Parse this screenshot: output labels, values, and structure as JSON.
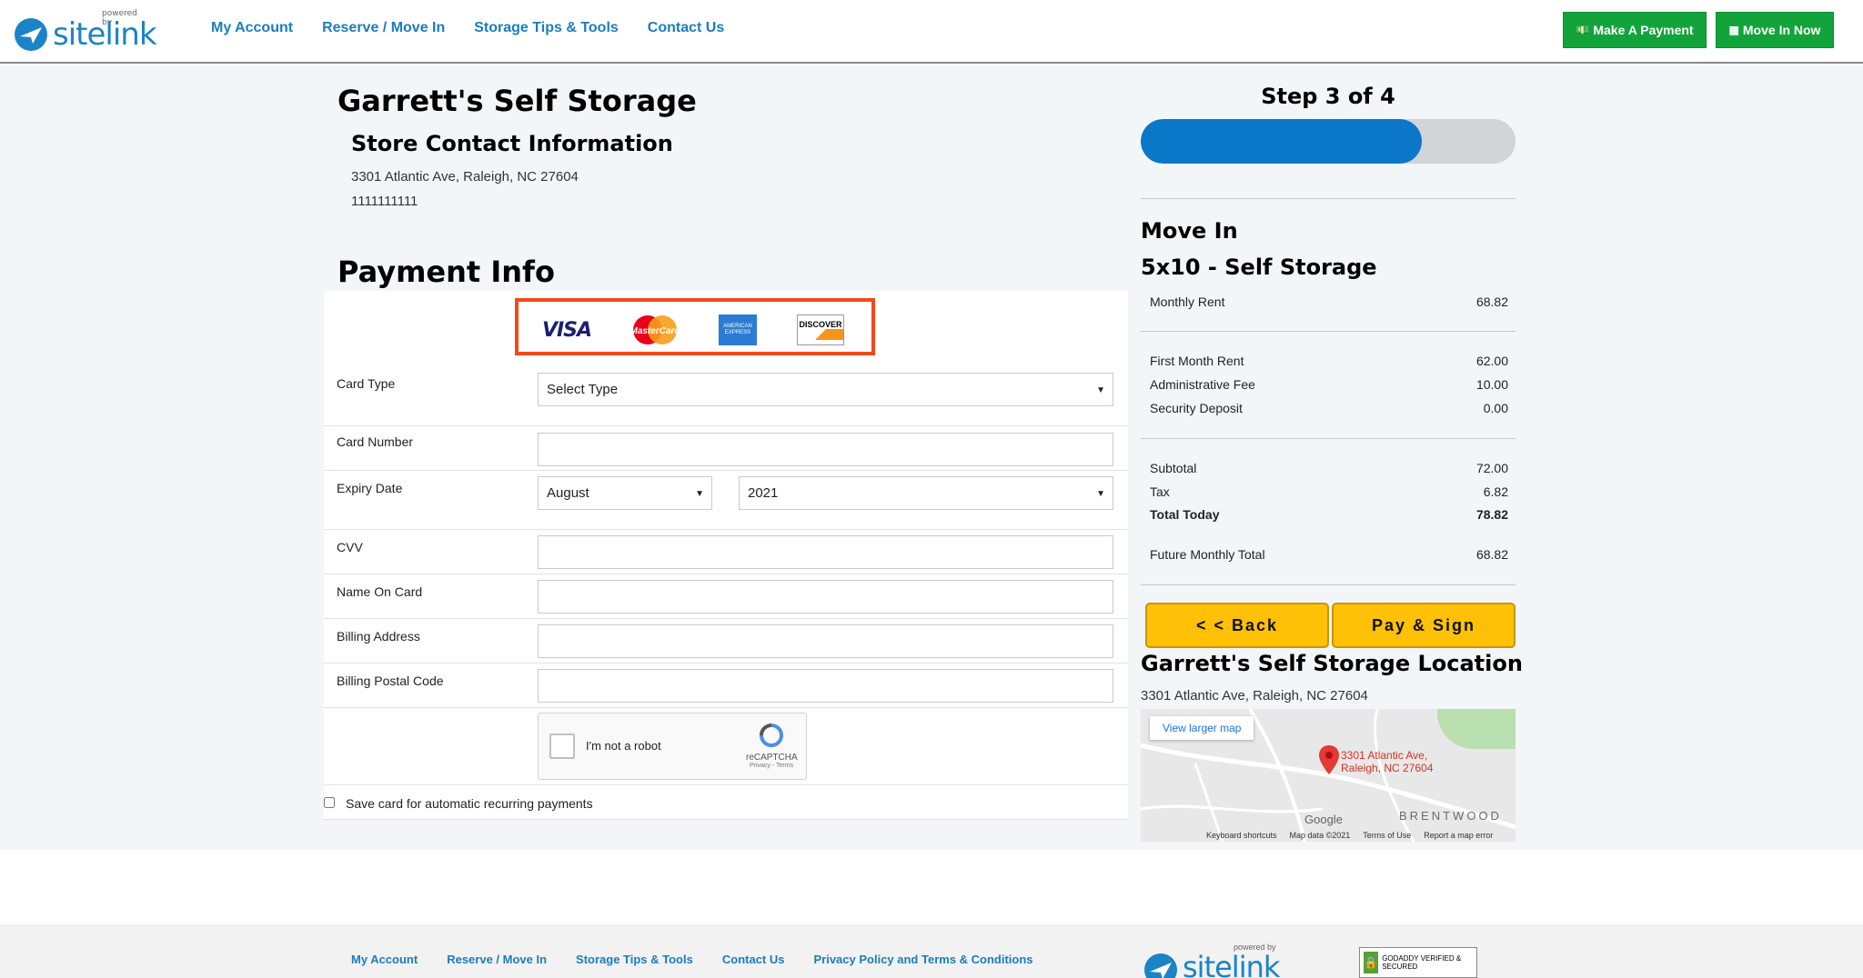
{
  "header": {
    "logo_powered": "powered by",
    "logo_word": "sitelink",
    "nav": [
      "My Account",
      "Reserve / Move In",
      "Storage Tips & Tools",
      "Contact Us"
    ],
    "make_payment": "Make A Payment",
    "move_in_now": "Move In Now"
  },
  "store": {
    "title": "Garrett's Self Storage",
    "contact_heading": "Store Contact Information",
    "address": "3301 Atlantic Ave, Raleigh, NC 27604",
    "phone": "1111111111"
  },
  "payment": {
    "heading": "Payment Info",
    "cards": {
      "visa": "VISA",
      "mastercard": "MasterCard",
      "amex": "AMERICAN EXPRESS",
      "discover": "DISCOVER"
    },
    "card_type_label": "Card Type",
    "card_type_value": "Select Type",
    "card_number_label": "Card Number",
    "expiry_label": "Expiry Date",
    "expiry_month": "August",
    "expiry_year": "2021",
    "cvv_label": "CVV",
    "name_label": "Name On Card",
    "billing_address_label": "Billing Address",
    "billing_postal_label": "Billing Postal Code",
    "captcha_text": "I'm not a robot",
    "captcha_brand": "reCAPTCHA",
    "captcha_links": "Privacy - Terms",
    "save_card": "Save card for automatic recurring payments"
  },
  "summary": {
    "step": "Step 3 of 4",
    "progress": 0.75,
    "move_in": "Move In",
    "unit": "5x10 - Self Storage",
    "monthly_rent_label": "Monthly Rent",
    "monthly_rent": "68.82",
    "first_month_label": "First Month Rent",
    "first_month": "62.00",
    "admin_fee_label": "Administrative Fee",
    "admin_fee": "10.00",
    "security_label": "Security Deposit",
    "security": "0.00",
    "subtotal_label": "Subtotal",
    "subtotal": "72.00",
    "tax_label": "Tax",
    "tax": "6.82",
    "total_label": "Total Today",
    "total": "78.82",
    "future_label": "Future Monthly Total",
    "future": "68.82",
    "back": "< < Back",
    "pay_sign": "Pay & Sign"
  },
  "location": {
    "heading": "Garrett's Self Storage Location",
    "address": "3301 Atlantic Ave, Raleigh, NC 27604",
    "view_larger": "View larger map",
    "pin_line1": "3301 Atlantic Ave,",
    "pin_line2": "Raleigh, NC 27604",
    "area": "BRENTWOOD",
    "google": "Google",
    "map_footer": [
      "Keyboard shortcuts",
      "Map data ©2021",
      "Terms of Use",
      "Report a map error"
    ]
  },
  "footer": {
    "nav": [
      "My Account",
      "Reserve / Move In",
      "Storage Tips & Tools",
      "Contact Us",
      "Privacy Policy and Terms & Conditions"
    ],
    "logo_powered": "powered by",
    "logo_word": "sitelink",
    "badge": "GODADDY VERIFIED & SECURED"
  },
  "colors": {
    "brand_blue": "#1c7cbf",
    "green": "#12a43a",
    "yellow": "#ffc107",
    "progress": "#0a77c9",
    "highlight": "#f04a1c"
  }
}
